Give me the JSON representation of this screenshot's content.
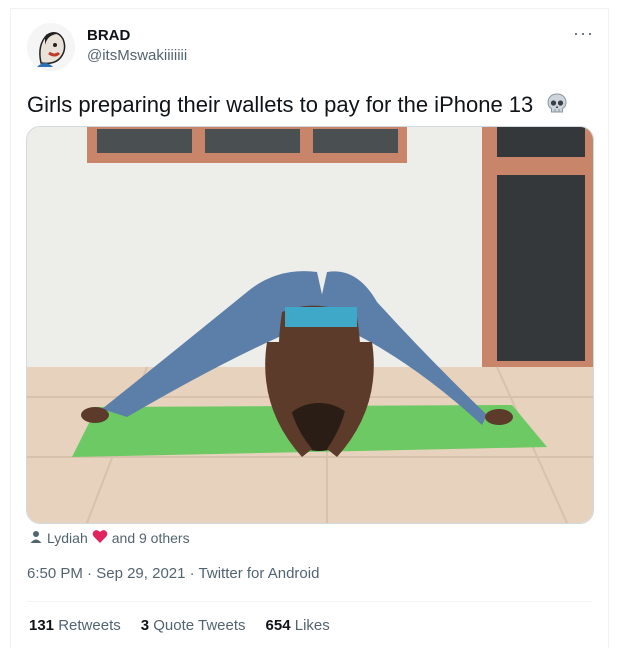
{
  "author": {
    "name": "BRAD",
    "handle": "@itsMswakiiiiiii"
  },
  "tweet": {
    "text": "Girls preparing their wallets to pay for the iPhone 13",
    "emoji_icon": "skull-icon"
  },
  "tagged": {
    "person": "Lydiah",
    "emoji_icon": "red-heart-icon",
    "others": "and 9 others"
  },
  "meta": {
    "time": "6:50 PM",
    "separator1": "·",
    "date": "Sep 29, 2021",
    "separator2": "·",
    "client": "Twitter for Android"
  },
  "stats": {
    "retweets_count": "131",
    "retweets_label": "Retweets",
    "quotes_count": "3",
    "quotes_label": "Quote Tweets",
    "likes_count": "654",
    "likes_label": "Likes"
  },
  "colors": {
    "text": "#0f1419",
    "secondary": "#536471",
    "border": "#cfd9de",
    "mat": "#6cc963",
    "heart": "#e0245e"
  }
}
